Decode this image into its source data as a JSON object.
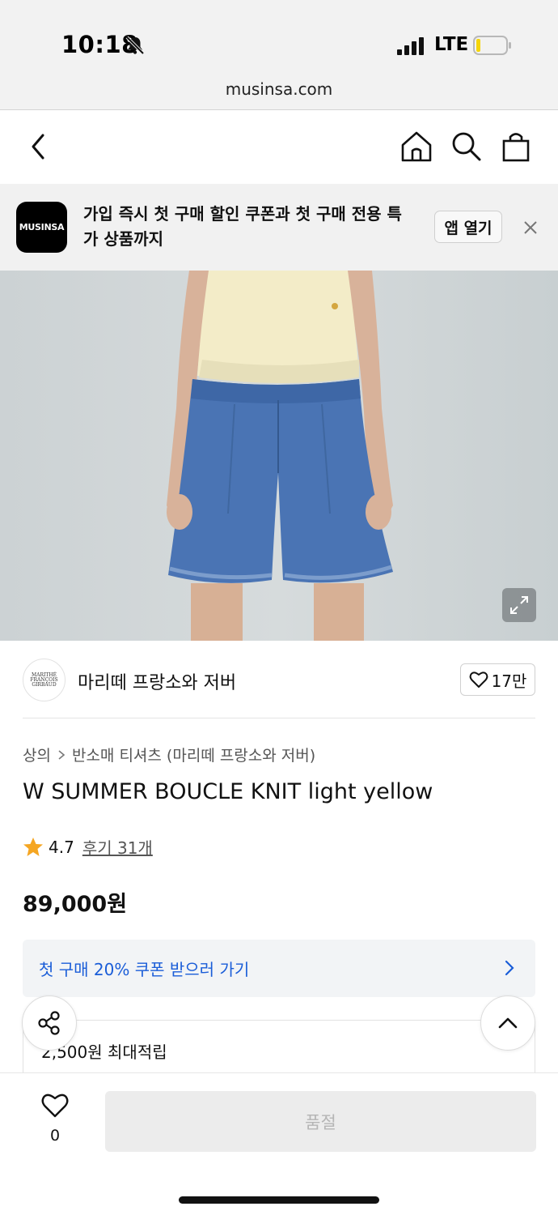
{
  "status_bar": {
    "time": "10:18",
    "network": "LTE",
    "icons": [
      "bell-slash-icon",
      "signal-icon",
      "battery-icon"
    ]
  },
  "browser": {
    "url": "musinsa.com"
  },
  "nav": {
    "icons": [
      "back-icon",
      "home-icon",
      "search-icon",
      "bag-icon"
    ]
  },
  "app_banner": {
    "logo_text": "MUSINSA",
    "message": "가입 즉시 첫 구매 할인 쿠폰과 첫 구매 전용 특가 상품까지",
    "open_button": "앱 열기",
    "close_icon": "close-icon"
  },
  "brand": {
    "logo_text": "MARITHÉ FRANÇOIS GIRBAUD",
    "name": "마리떼 프랑소와 저버",
    "likes": "17만"
  },
  "breadcrumb": {
    "category": "상의",
    "subcategory": "반소매 티셔츠 (마리떼 프랑소와 저버)"
  },
  "product": {
    "title": "W SUMMER BOUCLE KNIT light yellow",
    "rating": "4.7",
    "review_link": "후기 31개",
    "price": "89,000원"
  },
  "coupon": {
    "label": "첫 구매 20% 쿠폰 받으러 가기"
  },
  "points": {
    "label": "2,500원 최대적립"
  },
  "bottom_bar": {
    "wish_count": "0",
    "action_label": "품절"
  },
  "colors": {
    "accent_blue": "#1a5dd8",
    "star": "#f5a623",
    "soldout_bg": "#ececec"
  }
}
